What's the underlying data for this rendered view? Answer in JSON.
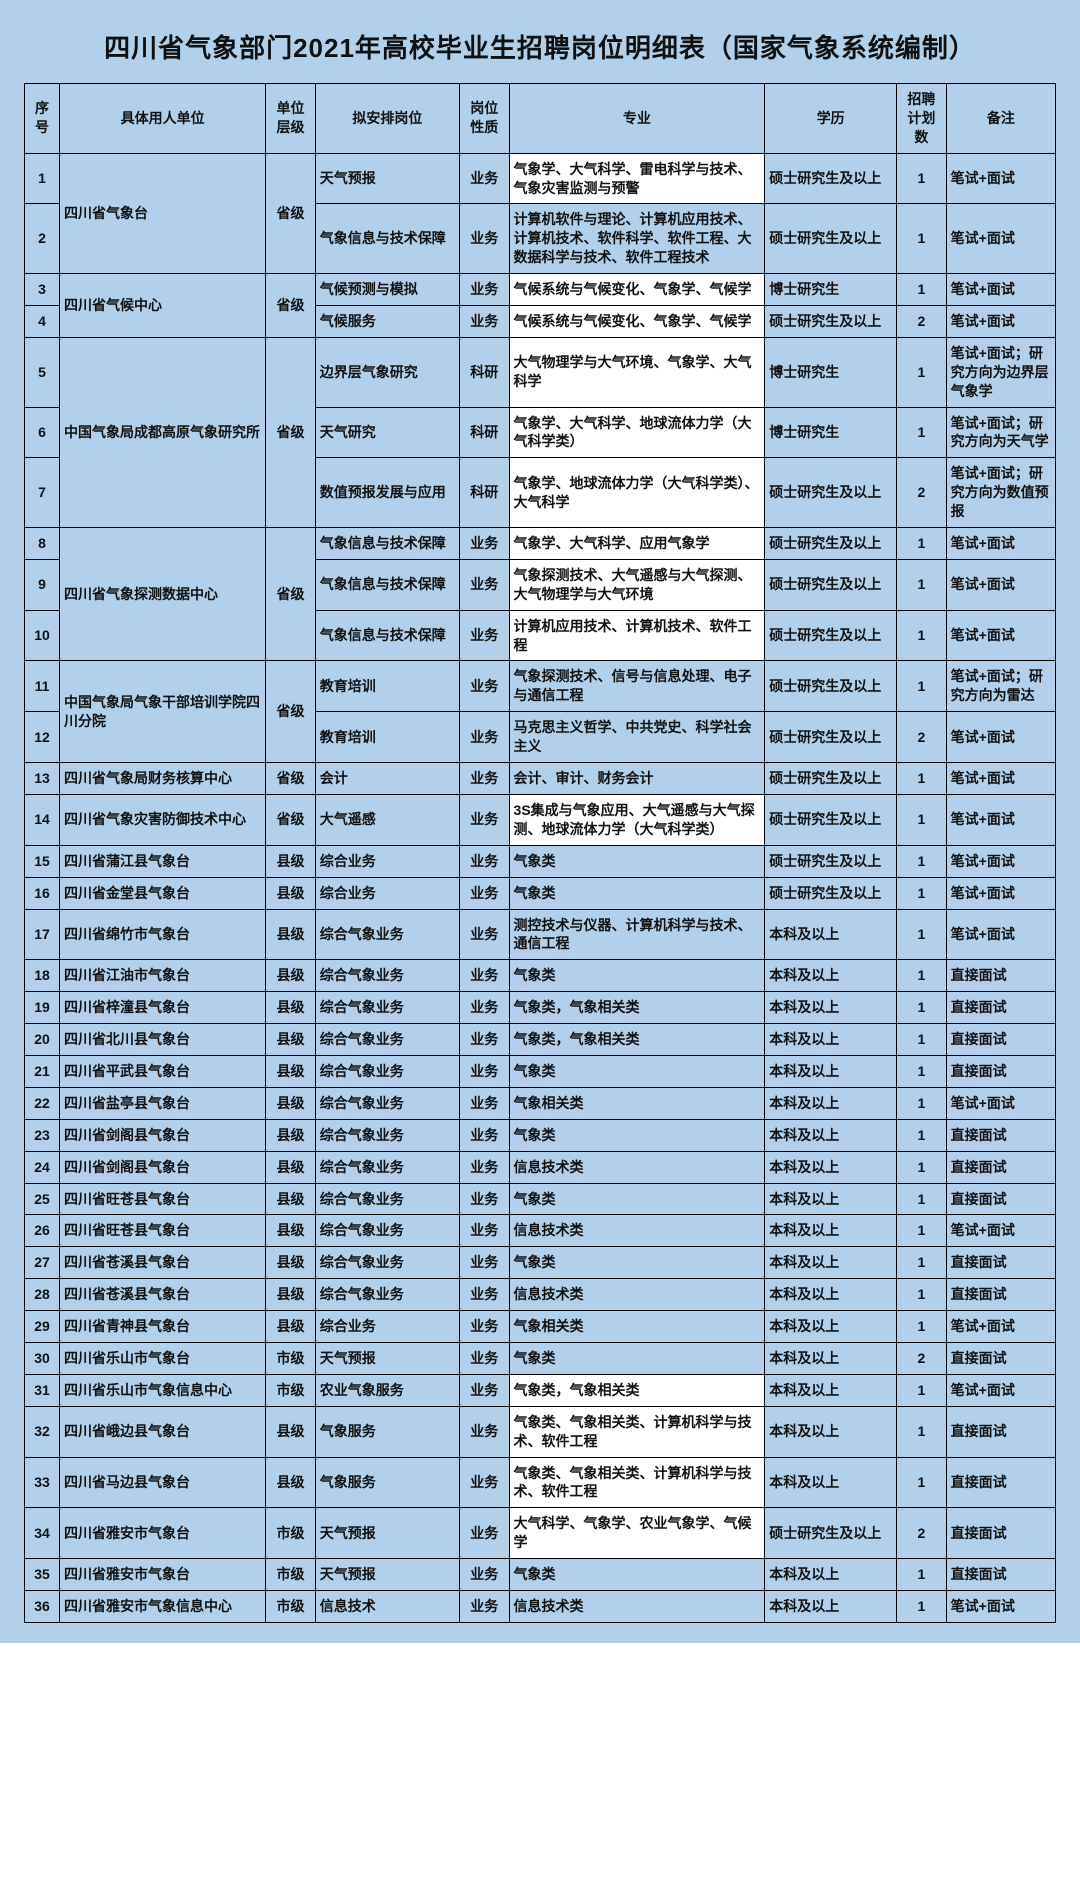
{
  "title": "四川省气象部门2021年高校毕业生招聘岗位明细表（国家气象系统编制）",
  "headers": {
    "idx": "序号",
    "unit": "具体用人单位",
    "level": "单位层级",
    "post": "拟安排岗位",
    "nature": "岗位性质",
    "major": "专业",
    "edu": "学历",
    "num": "招聘计划数",
    "note": "备注"
  },
  "rows": [
    {
      "idx": "1",
      "unit": "四川省气象台",
      "unitRowspan": 2,
      "level": "省级",
      "levelRowspan": 2,
      "post": "天气预报",
      "nature": "业务",
      "major": "气象学、大气科学、雷电科学与技术、气象灾害监测与预警",
      "majorHL": true,
      "edu": "硕士研究生及以上",
      "num": "1",
      "note": "笔试+面试"
    },
    {
      "idx": "2",
      "post": "气象信息与技术保障",
      "nature": "业务",
      "major": "计算机软件与理论、计算机应用技术、计算机技术、软件科学、软件工程、大数据科学与技术、软件工程技术",
      "edu": "硕士研究生及以上",
      "num": "1",
      "note": "笔试+面试"
    },
    {
      "idx": "3",
      "unit": "四川省气候中心",
      "unitRowspan": 2,
      "level": "省级",
      "levelRowspan": 2,
      "post": "气候预测与模拟",
      "nature": "业务",
      "major": "气候系统与气候变化、气象学、气候学",
      "majorHL": true,
      "edu": "博士研究生",
      "num": "1",
      "note": "笔试+面试"
    },
    {
      "idx": "4",
      "post": "气候服务",
      "nature": "业务",
      "major": "气候系统与气候变化、气象学、气候学",
      "majorHL": true,
      "edu": "硕士研究生及以上",
      "num": "2",
      "note": "笔试+面试"
    },
    {
      "idx": "5",
      "unit": "中国气象局成都高原气象研究所",
      "unitRowspan": 3,
      "level": "省级",
      "levelRowspan": 3,
      "post": "边界层气象研究",
      "nature": "科研",
      "major": "大气物理学与大气环境、气象学、大气科学",
      "majorHL": true,
      "edu": "博士研究生",
      "num": "1",
      "note": "笔试+面试；研究方向为边界层气象学"
    },
    {
      "idx": "6",
      "post": "天气研究",
      "nature": "科研",
      "major": "气象学、大气科学、地球流体力学（大气科学类）",
      "majorHL": true,
      "edu": "博士研究生",
      "num": "1",
      "note": "笔试+面试；研究方向为天气学"
    },
    {
      "idx": "7",
      "post": "数值预报发展与应用",
      "nature": "科研",
      "major": "气象学、地球流体力学（大气科学类）、大气科学",
      "majorHL": true,
      "edu": "硕士研究生及以上",
      "num": "2",
      "note": "笔试+面试；研究方向为数值预报"
    },
    {
      "idx": "8",
      "unit": "四川省气象探测数据中心",
      "unitRowspan": 3,
      "level": "省级",
      "levelRowspan": 3,
      "post": "气象信息与技术保障",
      "nature": "业务",
      "major": "气象学、大气科学、应用气象学",
      "majorHL": true,
      "edu": "硕士研究生及以上",
      "num": "1",
      "note": "笔试+面试"
    },
    {
      "idx": "9",
      "post": "气象信息与技术保障",
      "nature": "业务",
      "major": "气象探测技术、大气遥感与大气探测、大气物理学与大气环境",
      "majorHL": true,
      "edu": "硕士研究生及以上",
      "num": "1",
      "note": "笔试+面试"
    },
    {
      "idx": "10",
      "post": "气象信息与技术保障",
      "nature": "业务",
      "major": "计算机应用技术、计算机技术、软件工程",
      "majorHL": true,
      "edu": "硕士研究生及以上",
      "num": "1",
      "note": "笔试+面试"
    },
    {
      "idx": "11",
      "unit": "中国气象局气象干部培训学院四川分院",
      "unitRowspan": 2,
      "level": "省级",
      "levelRowspan": 2,
      "post": "教育培训",
      "nature": "业务",
      "major": "气象探测技术、信号与信息处理、电子与通信工程",
      "edu": "硕士研究生及以上",
      "num": "1",
      "note": "笔试+面试；研究方向为雷达"
    },
    {
      "idx": "12",
      "post": "教育培训",
      "nature": "业务",
      "major": "马克思主义哲学、中共党史、科学社会主义",
      "edu": "硕士研究生及以上",
      "num": "2",
      "note": "笔试+面试"
    },
    {
      "idx": "13",
      "unit": "四川省气象局财务核算中心",
      "level": "省级",
      "post": "会计",
      "nature": "业务",
      "major": "会计、审计、财务会计",
      "edu": "硕士研究生及以上",
      "num": "1",
      "note": "笔试+面试"
    },
    {
      "idx": "14",
      "unit": "四川省气象灾害防御技术中心",
      "level": "省级",
      "post": "大气遥感",
      "nature": "业务",
      "major": "3S集成与气象应用、大气遥感与大气探测、地球流体力学（大气科学类）",
      "majorHL": true,
      "edu": "硕士研究生及以上",
      "num": "1",
      "note": "笔试+面试"
    },
    {
      "idx": "15",
      "unit": "四川省蒲江县气象台",
      "level": "县级",
      "post": "综合业务",
      "nature": "业务",
      "major": "气象类",
      "edu": "硕士研究生及以上",
      "num": "1",
      "note": "笔试+面试"
    },
    {
      "idx": "16",
      "unit": "四川省金堂县气象台",
      "level": "县级",
      "post": "综合业务",
      "nature": "业务",
      "major": "气象类",
      "edu": "硕士研究生及以上",
      "num": "1",
      "note": "笔试+面试"
    },
    {
      "idx": "17",
      "unit": "四川省绵竹市气象台",
      "level": "县级",
      "post": "综合气象业务",
      "nature": "业务",
      "major": "测控技术与仪器、计算机科学与技术、通信工程",
      "edu": "本科及以上",
      "num": "1",
      "note": "笔试+面试"
    },
    {
      "idx": "18",
      "unit": "四川省江油市气象台",
      "level": "县级",
      "post": "综合气象业务",
      "nature": "业务",
      "major": "气象类",
      "edu": "本科及以上",
      "num": "1",
      "note": "直接面试"
    },
    {
      "idx": "19",
      "unit": "四川省梓潼县气象台",
      "level": "县级",
      "post": "综合气象业务",
      "nature": "业务",
      "major": "气象类，气象相关类",
      "edu": "本科及以上",
      "num": "1",
      "note": "直接面试"
    },
    {
      "idx": "20",
      "unit": "四川省北川县气象台",
      "level": "县级",
      "post": "综合气象业务",
      "nature": "业务",
      "major": "气象类，气象相关类",
      "edu": "本科及以上",
      "num": "1",
      "note": "直接面试"
    },
    {
      "idx": "21",
      "unit": "四川省平武县气象台",
      "level": "县级",
      "post": "综合气象业务",
      "nature": "业务",
      "major": "气象类",
      "edu": "本科及以上",
      "num": "1",
      "note": "直接面试"
    },
    {
      "idx": "22",
      "unit": "四川省盐亭县气象台",
      "level": "县级",
      "post": "综合气象业务",
      "nature": "业务",
      "major": "气象相关类",
      "edu": "本科及以上",
      "num": "1",
      "note": "笔试+面试"
    },
    {
      "idx": "23",
      "unit": "四川省剑阁县气象台",
      "level": "县级",
      "post": "综合气象业务",
      "nature": "业务",
      "major": "气象类",
      "edu": "本科及以上",
      "num": "1",
      "note": "直接面试"
    },
    {
      "idx": "24",
      "unit": "四川省剑阁县气象台",
      "level": "县级",
      "post": "综合气象业务",
      "nature": "业务",
      "major": "信息技术类",
      "edu": "本科及以上",
      "num": "1",
      "note": "直接面试"
    },
    {
      "idx": "25",
      "unit": "四川省旺苍县气象台",
      "level": "县级",
      "post": "综合气象业务",
      "nature": "业务",
      "major": "气象类",
      "edu": "本科及以上",
      "num": "1",
      "note": "直接面试"
    },
    {
      "idx": "26",
      "unit": "四川省旺苍县气象台",
      "level": "县级",
      "post": "综合气象业务",
      "nature": "业务",
      "major": "信息技术类",
      "edu": "本科及以上",
      "num": "1",
      "note": "笔试+面试"
    },
    {
      "idx": "27",
      "unit": "四川省苍溪县气象台",
      "level": "县级",
      "post": "综合气象业务",
      "nature": "业务",
      "major": "气象类",
      "edu": "本科及以上",
      "num": "1",
      "note": "直接面试"
    },
    {
      "idx": "28",
      "unit": "四川省苍溪县气象台",
      "level": "县级",
      "post": "综合气象业务",
      "nature": "业务",
      "major": "信息技术类",
      "edu": "本科及以上",
      "num": "1",
      "note": "直接面试"
    },
    {
      "idx": "29",
      "unit": "四川省青神县气象台",
      "level": "县级",
      "post": "综合业务",
      "nature": "业务",
      "major": "气象相关类",
      "edu": "本科及以上",
      "num": "1",
      "note": "笔试+面试"
    },
    {
      "idx": "30",
      "unit": "四川省乐山市气象台",
      "level": "市级",
      "post": "天气预报",
      "nature": "业务",
      "major": "气象类",
      "edu": "本科及以上",
      "num": "2",
      "note": "直接面试"
    },
    {
      "idx": "31",
      "unit": "四川省乐山市气象信息中心",
      "level": "市级",
      "post": "农业气象服务",
      "nature": "业务",
      "major": "气象类，气象相关类",
      "majorHL": true,
      "edu": "本科及以上",
      "num": "1",
      "note": "笔试+面试"
    },
    {
      "idx": "32",
      "unit": "四川省峨边县气象台",
      "level": "县级",
      "post": "气象服务",
      "nature": "业务",
      "major": "气象类、气象相关类、计算机科学与技术、软件工程",
      "majorHL": true,
      "edu": "本科及以上",
      "num": "1",
      "note": "直接面试"
    },
    {
      "idx": "33",
      "unit": "四川省马边县气象台",
      "level": "县级",
      "post": "气象服务",
      "nature": "业务",
      "major": "气象类、气象相关类、计算机科学与技术、软件工程",
      "majorHL": true,
      "edu": "本科及以上",
      "num": "1",
      "note": "直接面试"
    },
    {
      "idx": "34",
      "unit": "四川省雅安市气象台",
      "level": "市级",
      "post": "天气预报",
      "nature": "业务",
      "major": "大气科学、气象学、农业气象学、气候学",
      "majorHL": true,
      "edu": "硕士研究生及以上",
      "num": "2",
      "note": "直接面试"
    },
    {
      "idx": "35",
      "unit": "四川省雅安市气象台",
      "level": "市级",
      "post": "天气预报",
      "nature": "业务",
      "major": "气象类",
      "edu": "本科及以上",
      "num": "1",
      "note": "直接面试"
    },
    {
      "idx": "36",
      "unit": "四川省雅安市气象信息中心",
      "level": "市级",
      "post": "信息技术",
      "nature": "业务",
      "major": "信息技术类",
      "edu": "本科及以上",
      "num": "1",
      "note": "笔试+面试"
    }
  ]
}
